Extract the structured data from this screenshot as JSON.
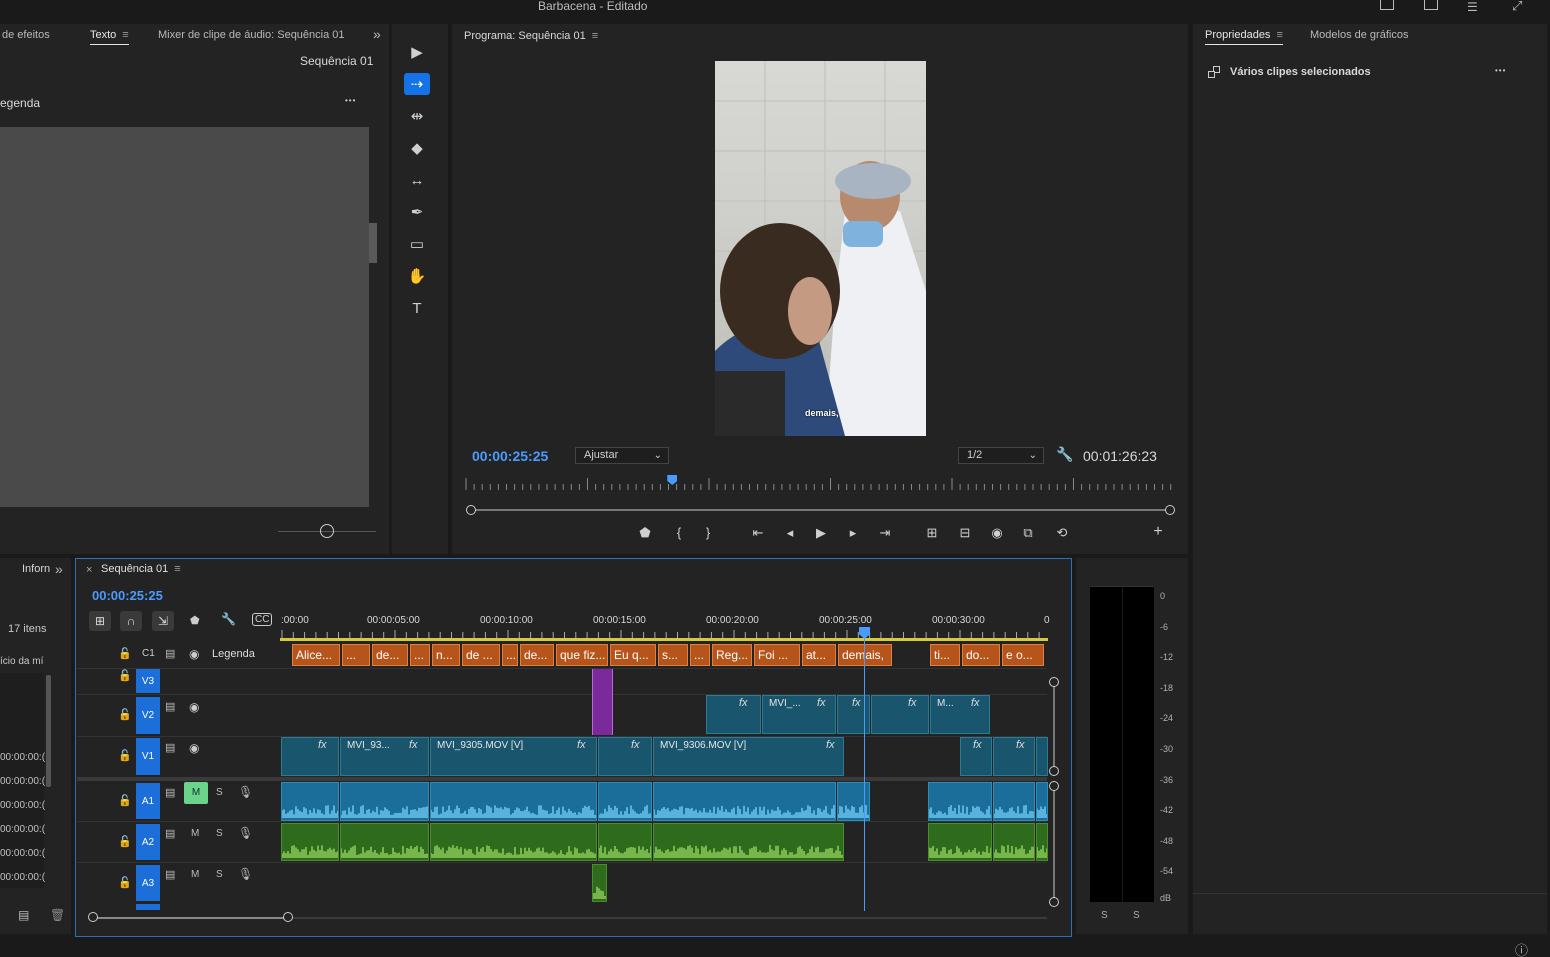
{
  "app": {
    "title": "Barbacena",
    "title_suffix": "- Editado"
  },
  "left_panel": {
    "tabs": [
      "de efeitos",
      "Texto",
      "Mixer de clipe de áudio: Sequência 01"
    ],
    "sequence_label": "Sequência 01",
    "track_label": "egenda"
  },
  "program_monitor": {
    "title": "Programa: Sequência 01",
    "current_time": "00:00:25:25",
    "fit": "Ajustar",
    "resolution": "1/2",
    "duration": "00:01:26:23",
    "caption_overlay": "demais,",
    "playhead_progress": 0.295
  },
  "properties": {
    "tabs": [
      "Propriedades",
      "Modelos de gráficos"
    ],
    "selection_label": "Vários clipes selecionados"
  },
  "project_panel": {
    "tab": "Inforn",
    "count": "17 itens",
    "column": "ício da mí",
    "rows": [
      "00:00:00:(",
      "00:00:00:(",
      "00:00:00:(",
      "00:00:00:(",
      "00:00:00:(",
      "00:00:00:("
    ]
  },
  "timeline": {
    "tab": "Sequência 01",
    "close": "×",
    "timecode": "00:00:25:25",
    "ruler": [
      ":00:00",
      "00:00:05:00",
      "00:00:10:00",
      "00:00:15:00",
      "00:00:20:00",
      "00:00:25:00",
      "00:00:30:00",
      "0"
    ],
    "caption_track": {
      "id": "C1",
      "name": "Legenda"
    },
    "tracks": {
      "V3": "V3",
      "V2": "V2",
      "V1": "V1",
      "A1": "A1",
      "A2": "A2",
      "A3": "A3",
      "mute": "M",
      "solo": "S"
    },
    "captions": [
      "Alice...",
      "...",
      "de...",
      "...",
      "n...",
      "de ...",
      "...",
      "de...",
      "que fiz...",
      "Eu q...",
      "s...",
      "...",
      "Reg...",
      "Foi ...",
      "at...",
      "demais,",
      "ti...",
      "do...",
      "e o..."
    ],
    "v1_clips": [
      "MVI_93...",
      "MVI_9305.MOV [V]",
      "MVI_9306.MOV [V]"
    ],
    "v2_clips": [
      "MVI_...",
      "M..."
    ],
    "fx": "fx"
  },
  "meter": {
    "labels": [
      "0",
      "-6",
      "-12",
      "-18",
      "-24",
      "-30",
      "-36",
      "-42",
      "-48",
      "-54",
      "dB"
    ],
    "solo": [
      "S",
      "S"
    ]
  },
  "icons": {
    "hamburger": "≡",
    "chevron": "»",
    "more": "•••",
    "info": "ⓘ"
  },
  "colors": {
    "accent": "#1473e6",
    "timecode": "#4a9bff",
    "caption": "#b5551c",
    "video_clip": "#19566e",
    "audio_a1": "#1a6e99",
    "audio_a2": "#2f6b1c"
  }
}
